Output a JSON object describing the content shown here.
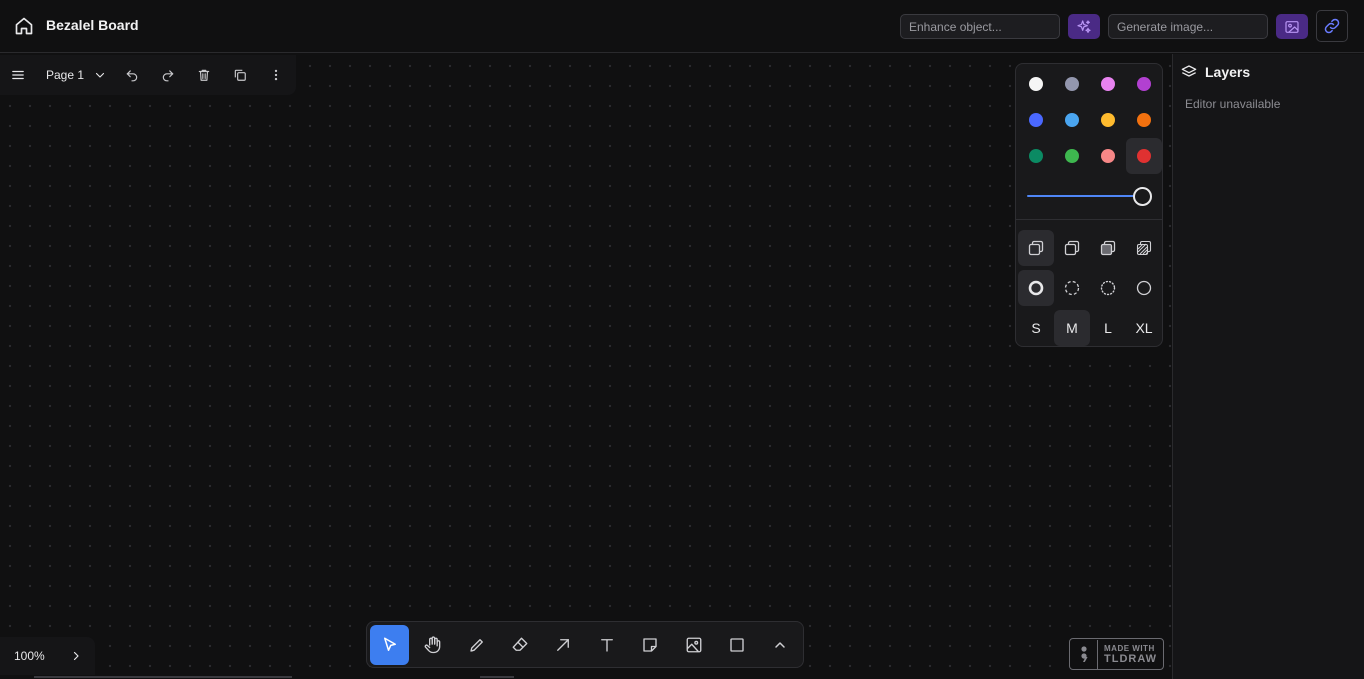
{
  "header": {
    "title": "Bezalel Board",
    "enhance_placeholder": "Enhance object...",
    "generate_placeholder": "Generate image..."
  },
  "page_menu": {
    "page_name": "Page 1"
  },
  "style_panel": {
    "colors": [
      {
        "name": "white",
        "hex": "#f5f5f5"
      },
      {
        "name": "grey",
        "hex": "#9397ae"
      },
      {
        "name": "light-violet",
        "hex": "#e883f0"
      },
      {
        "name": "violet",
        "hex": "#b240d1"
      },
      {
        "name": "blue",
        "hex": "#4a68ff"
      },
      {
        "name": "light-blue",
        "hex": "#4aa5f0"
      },
      {
        "name": "yellow",
        "hex": "#ffbb2e"
      },
      {
        "name": "orange",
        "hex": "#f2710f"
      },
      {
        "name": "green",
        "hex": "#0b8a63"
      },
      {
        "name": "light-green",
        "hex": "#3eb74f"
      },
      {
        "name": "light-red",
        "hex": "#f78787"
      },
      {
        "name": "red",
        "hex": "#e03131"
      }
    ],
    "selected_color": "red",
    "opacity": 1.0,
    "sizes": [
      "S",
      "M",
      "L",
      "XL"
    ],
    "selected_size": "M"
  },
  "sidebar": {
    "title": "Layers",
    "status": "Editor unavailable"
  },
  "zoom": {
    "label": "100%"
  },
  "toolbar": {
    "tools": [
      "select",
      "hand",
      "draw",
      "eraser",
      "arrow",
      "text",
      "note",
      "asset",
      "rectangle",
      "more"
    ],
    "active_tool": "select"
  },
  "watermark": {
    "line1": "MADE WITH",
    "line2": "TLDRAW"
  }
}
